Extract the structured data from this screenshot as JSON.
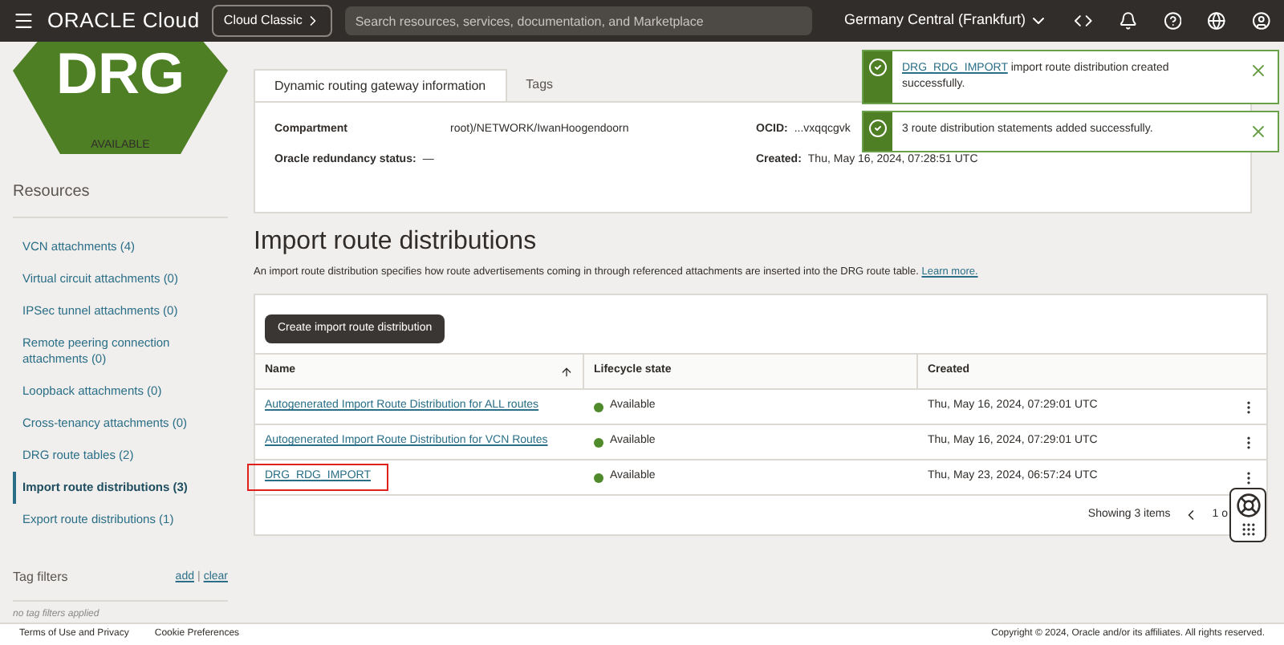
{
  "header": {
    "brand": "ORACLE Cloud",
    "classic_button": "Cloud Classic",
    "search": {
      "placeholder": "Search resources, services, documentation, and Marketplace"
    },
    "region": "Germany Central (Frankfurt)"
  },
  "resource": {
    "logo_text": "DRG",
    "status": "AVAILABLE"
  },
  "sidebar": {
    "title": "Resources",
    "items": [
      {
        "label": "VCN attachments (4)",
        "selected": false
      },
      {
        "label": "Virtual circuit attachments (0)",
        "selected": false
      },
      {
        "label": "IPSec tunnel attachments (0)",
        "selected": false
      },
      {
        "label": "Remote peering connection attachments (0)",
        "selected": false
      },
      {
        "label": "Loopback attachments (0)",
        "selected": false
      },
      {
        "label": "Cross-tenancy attachments (0)",
        "selected": false
      },
      {
        "label": "DRG route tables (2)",
        "selected": false
      },
      {
        "label": "Import route distributions (3)",
        "selected": true
      },
      {
        "label": "Export route distributions (1)",
        "selected": false
      }
    ],
    "tag_filters": {
      "title": "Tag filters",
      "add": "add",
      "separator": "|",
      "clear": "clear",
      "empty": "no tag filters applied"
    }
  },
  "info_panel": {
    "tabs": [
      {
        "label": "Dynamic routing gateway information",
        "selected": true
      },
      {
        "label": "Tags",
        "selected": false
      }
    ],
    "fields": [
      {
        "label": "Compartment",
        "value": "root)/NETWORK/IwanHoogendoorn"
      },
      {
        "label": "OCID:",
        "value": "...vxqqcgvk"
      },
      {
        "label": "Oracle redundancy status:",
        "value": "—"
      },
      {
        "label": "Created:",
        "value": "Thu, May 16, 2024, 07:28:51 UTC"
      }
    ]
  },
  "section": {
    "title": "Import route distributions",
    "description": "An import route distribution specifies how route advertisements coming in through referenced attachments are inserted into the DRG route table.",
    "learn_more": "Learn more."
  },
  "table": {
    "create_button": "Create import route distribution",
    "columns": [
      "Name",
      "Lifecycle state",
      "Created"
    ],
    "rows": [
      {
        "name": "Autogenerated Import Route Distribution for ALL routes",
        "state": "Available",
        "color": "#4f8a2b",
        "created": "Thu, May 16, 2024, 07:29:01 UTC",
        "highlighted": false
      },
      {
        "name": "Autogenerated Import Route Distribution for VCN Routes",
        "state": "Available",
        "color": "#4f8a2b",
        "created": "Thu, May 16, 2024, 07:29:01 UTC",
        "highlighted": false
      },
      {
        "name": "DRG_RDG_IMPORT",
        "state": "Available",
        "color": "#4f8a2b",
        "created": "Thu, May 23, 2024, 06:57:24 UTC",
        "highlighted": true
      }
    ],
    "footer": {
      "count": "Showing 3 items",
      "page": "1 o"
    }
  },
  "toasts": [
    {
      "link": "DRG_RDG_IMPORT",
      "message": "import route distribution created successfully."
    },
    {
      "message": "3 route distribution statements added successfully."
    }
  ],
  "footer": {
    "links": [
      "Terms of Use and Privacy",
      "Cookie Preferences"
    ],
    "copyright": "Copyright © 2024, Oracle and/or its affiliates. All rights reserved."
  }
}
